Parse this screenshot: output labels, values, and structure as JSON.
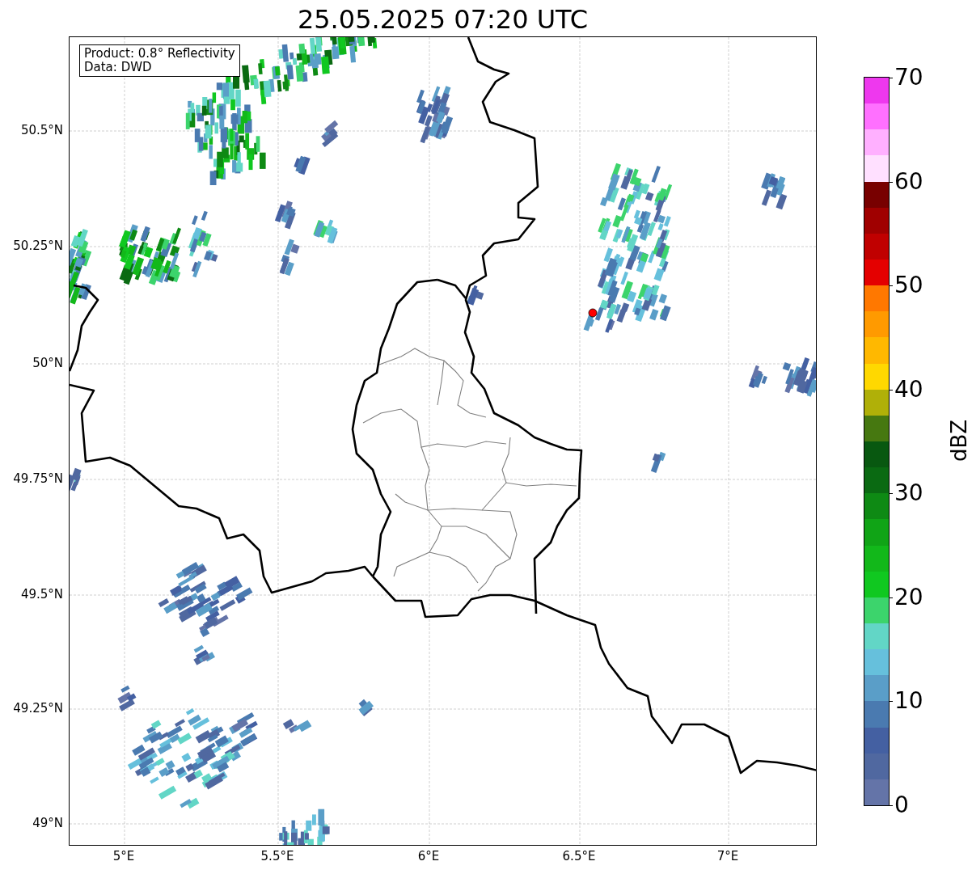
{
  "title": "25.05.2025 07:20 UTC",
  "info_box": [
    "Product: 0.8° Reflectivity",
    "Data: DWD"
  ],
  "map": {
    "lat_labels": [
      "50.5°N",
      "50.25°N",
      "50°N",
      "49.75°N",
      "49.5°N",
      "49.25°N",
      "49°N"
    ],
    "lon_labels": [
      "5°E",
      "5.5°E",
      "6°E",
      "6.5°E",
      "7°E"
    ]
  },
  "colorbar": {
    "label": "dBZ",
    "ticks": [
      "70",
      "60",
      "50",
      "40",
      "30",
      "20",
      "10",
      "0"
    ],
    "bins": [
      {
        "color": "#6474a8"
      },
      {
        "color": "#5068a0"
      },
      {
        "color": "#4460a2"
      },
      {
        "color": "#4a7ab0"
      },
      {
        "color": "#5a9ec8"
      },
      {
        "color": "#66c0dc"
      },
      {
        "color": "#62d6c6"
      },
      {
        "color": "#3cd46c"
      },
      {
        "color": "#10c820"
      },
      {
        "color": "#12b81a"
      },
      {
        "color": "#10a416"
      },
      {
        "color": "#0e8a14"
      },
      {
        "color": "#0a6a12"
      },
      {
        "color": "#085810"
      },
      {
        "color": "#467810"
      },
      {
        "color": "#b0b008"
      },
      {
        "color": "#ffd800"
      },
      {
        "color": "#ffb800"
      },
      {
        "color": "#ff9a00"
      },
      {
        "color": "#ff7800"
      },
      {
        "color": "#e40000"
      },
      {
        "color": "#c00000"
      },
      {
        "color": "#a00000"
      },
      {
        "color": "#780000"
      },
      {
        "color": "#ffe0ff"
      },
      {
        "color": "#ffb0ff"
      },
      {
        "color": "#ff70ff"
      },
      {
        "color": "#ee38ee"
      }
    ]
  }
}
